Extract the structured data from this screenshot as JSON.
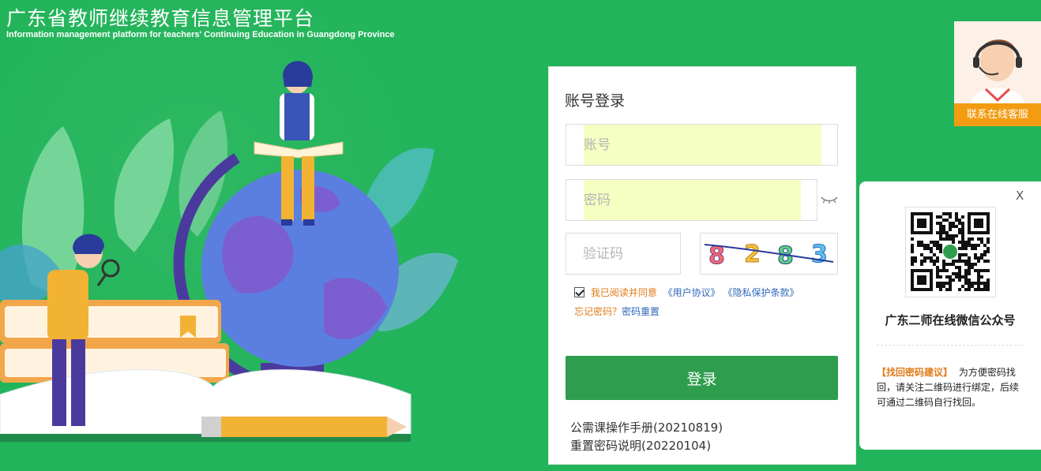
{
  "header": {
    "title": "广东省教师继续教育信息管理平台",
    "subtitle": "Information management platform for teachers' Continuing Education in Guangdong Province"
  },
  "login": {
    "title": "账号登录",
    "account_placeholder": "账号",
    "password_placeholder": "密码",
    "captcha_placeholder": "验证码",
    "captcha_text": "8283",
    "agree_prefix": "我已阅读并同意",
    "user_agreement": "《用户协议》",
    "privacy_policy": "《隐私保护条款》",
    "agree_checked": true,
    "forgot_password": "忘记密码？",
    "reset_password": "密码重置",
    "login_button": "登录",
    "links": [
      "公需课操作手册(20210819)",
      "重置密码说明(20220104)"
    ]
  },
  "customer_service": {
    "label": "联系在线客服"
  },
  "qr_panel": {
    "close": "X",
    "title": "广东二师在线微信公众号",
    "note_highlight": "【找回密码建议】",
    "note_text": "为方便密码找回，请关注二维码进行绑定，后续可通过二维码自行找回。"
  },
  "colors": {
    "background": "#22b45a",
    "button": "#2e9e4e",
    "accent_orange": "#e07b1a",
    "link_blue": "#2e66b8",
    "autofill_yellow": "#f6ffc2"
  }
}
